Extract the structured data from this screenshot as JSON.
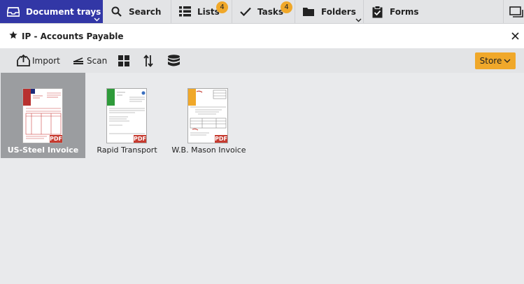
{
  "nav": {
    "document_trays": "Document trays",
    "search": "Search",
    "lists": "Lists",
    "lists_badge": "4",
    "tasks": "Tasks",
    "tasks_badge": "4",
    "folders": "Folders",
    "forms": "Forms"
  },
  "titlebar": {
    "title": "IP - Accounts Payable"
  },
  "toolbar": {
    "import_label": "Import",
    "scan_label": "Scan",
    "store_label": "Store"
  },
  "documents": [
    {
      "label": "US-Steel Invoice",
      "selected": true,
      "accent": "#b8312f"
    },
    {
      "label": "Rapid Transport",
      "selected": false,
      "accent": "#2e9b3a"
    },
    {
      "label": "W.B. Mason Invoice",
      "selected": false,
      "accent": "#f0a82a"
    }
  ],
  "colors": {
    "nav_active": "#3237a6",
    "accent": "#f0a82a",
    "pdf_badge": "#c63a2f"
  }
}
